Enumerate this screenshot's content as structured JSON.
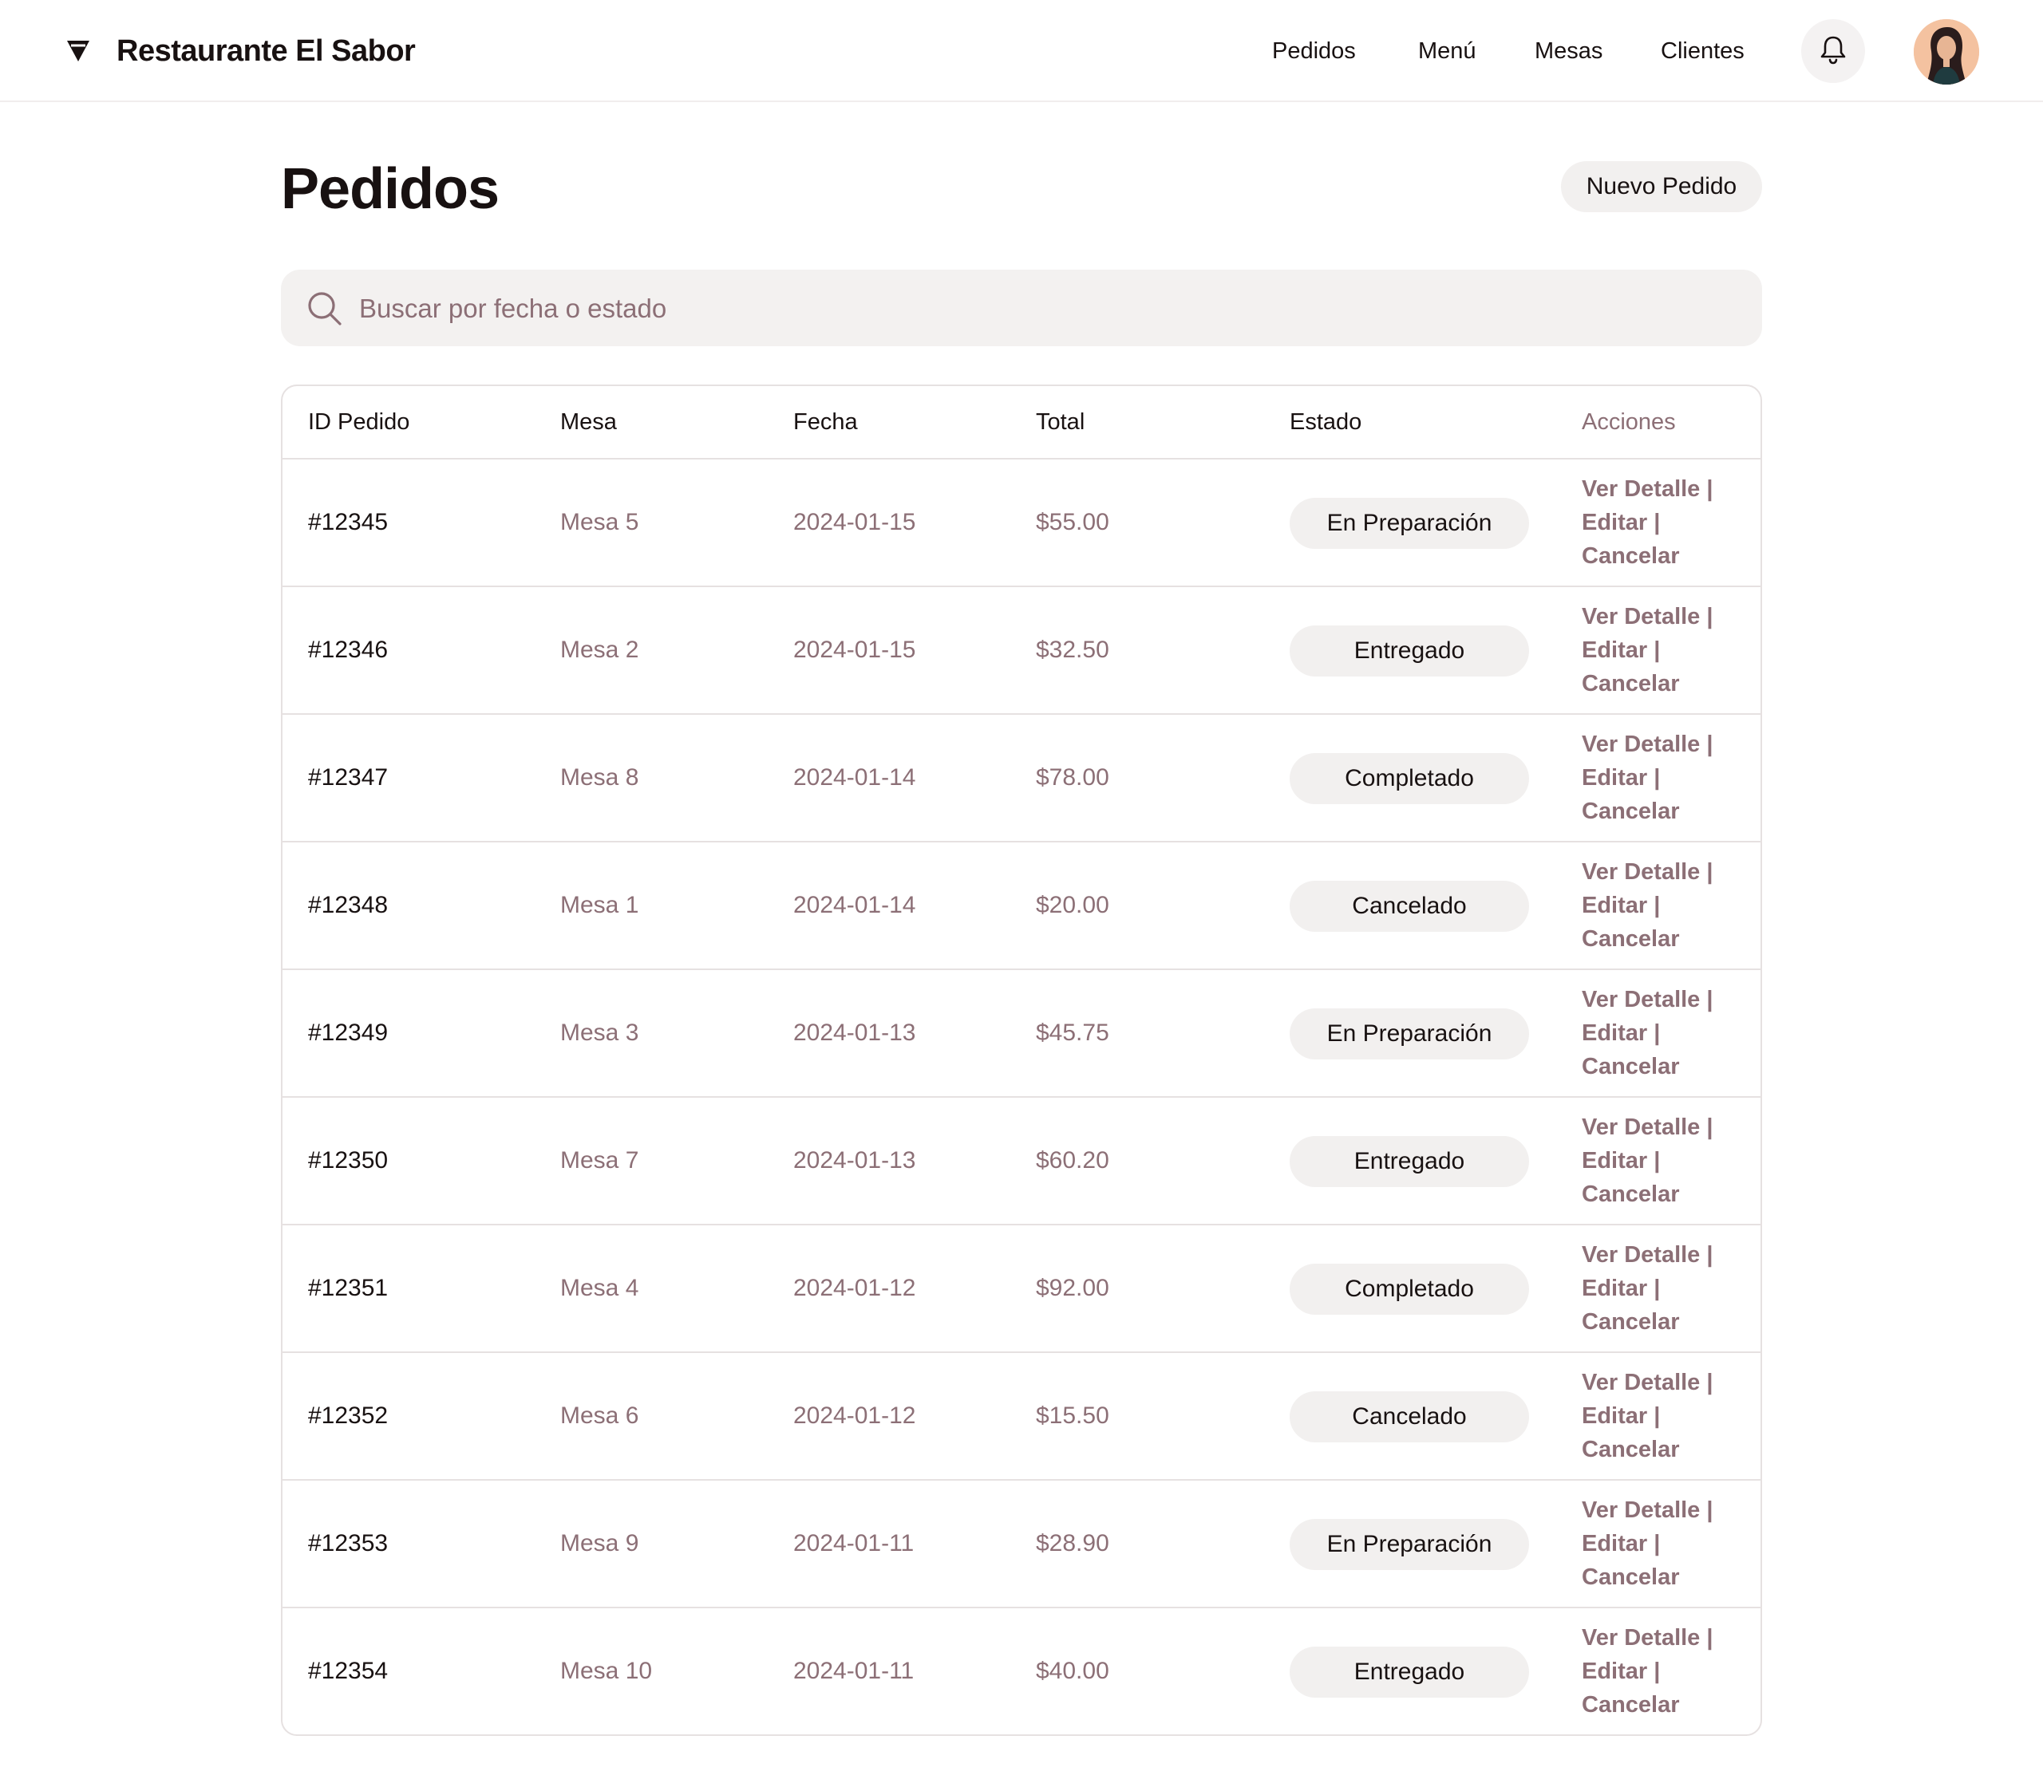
{
  "app": {
    "brand": "Restaurante El Sabor",
    "nav": [
      {
        "label": "Pedidos"
      },
      {
        "label": "Menú"
      },
      {
        "label": "Mesas"
      },
      {
        "label": "Clientes"
      }
    ],
    "icons": {
      "brand": "diamond-logo-icon",
      "notifications": "bell-icon",
      "search": "search-icon"
    }
  },
  "page": {
    "title": "Pedidos",
    "new_button": "Nuevo Pedido"
  },
  "search": {
    "placeholder": "Buscar por fecha o estado",
    "value": ""
  },
  "table": {
    "headers": [
      "ID Pedido",
      "Mesa",
      "Fecha",
      "Total",
      "Estado",
      "Acciones"
    ],
    "action_labels": [
      "Ver Detalle |",
      "Editar |",
      "Cancelar"
    ],
    "rows": [
      {
        "id": "#12345",
        "mesa": "Mesa 5",
        "fecha": "2024-01-15",
        "total": "$55.00",
        "estado": "En Preparación"
      },
      {
        "id": "#12346",
        "mesa": "Mesa 2",
        "fecha": "2024-01-15",
        "total": "$32.50",
        "estado": "Entregado"
      },
      {
        "id": "#12347",
        "mesa": "Mesa 8",
        "fecha": "2024-01-14",
        "total": "$78.00",
        "estado": "Completado"
      },
      {
        "id": "#12348",
        "mesa": "Mesa 1",
        "fecha": "2024-01-14",
        "total": "$20.00",
        "estado": "Cancelado"
      },
      {
        "id": "#12349",
        "mesa": "Mesa 3",
        "fecha": "2024-01-13",
        "total": "$45.75",
        "estado": "En Preparación"
      },
      {
        "id": "#12350",
        "mesa": "Mesa 7",
        "fecha": "2024-01-13",
        "total": "$60.20",
        "estado": "Entregado"
      },
      {
        "id": "#12351",
        "mesa": "Mesa 4",
        "fecha": "2024-01-12",
        "total": "$92.00",
        "estado": "Completado"
      },
      {
        "id": "#12352",
        "mesa": "Mesa 6",
        "fecha": "2024-01-12",
        "total": "$15.50",
        "estado": "Cancelado"
      },
      {
        "id": "#12353",
        "mesa": "Mesa 9",
        "fecha": "2024-01-11",
        "total": "$28.90",
        "estado": "En Preparación"
      },
      {
        "id": "#12354",
        "mesa": "Mesa 10",
        "fecha": "2024-01-11",
        "total": "$40.00",
        "estado": "Entregado"
      }
    ]
  },
  "colors": {
    "muted_text": "#8c6f76",
    "pill_bg": "#f2f0ef",
    "border": "#e6e1e1"
  }
}
